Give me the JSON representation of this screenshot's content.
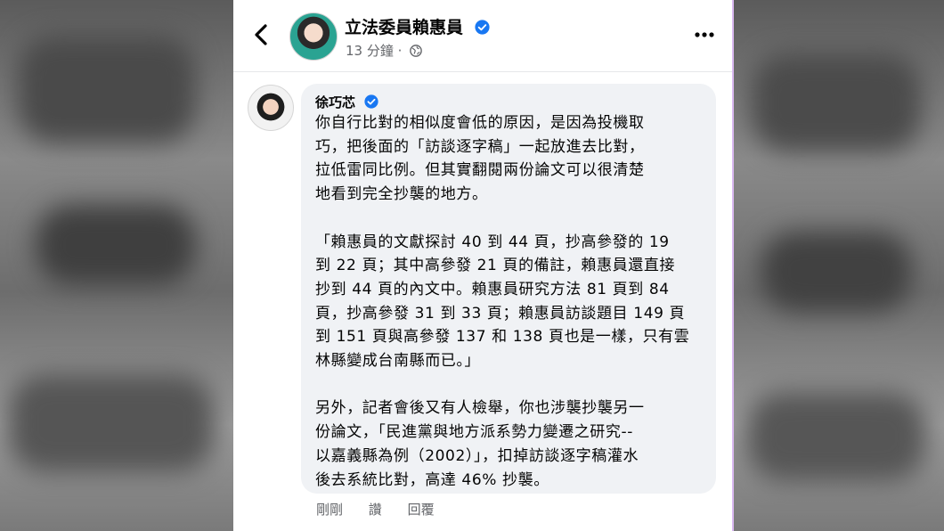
{
  "post": {
    "page_name": "立法委員賴惠員",
    "time": "13 分鐘",
    "separator": "·"
  },
  "comment": {
    "author": "徐巧芯",
    "paragraphs": [
      "你自行比對的相似度會低的原因，是因為投機取\n巧，把後面的「訪談逐字稿」一起放進去比對，\n拉低雷同比例。但其實翻閱兩份論文可以很清楚\n地看到完全抄襲的地方。",
      "「賴惠員的文獻探討 40 到 44 頁，抄高參發的 19\n到 22 頁；其中高參發 21 頁的備註，賴惠員還直接\n抄到 44 頁的內文中。賴惠員研究方法 81 頁到 84\n頁，抄高參發 31 到 33 頁；賴惠員訪談題目 149 頁\n到 151 頁與高參發 137 和 138 頁也是一樣，只有雲\n林縣變成台南縣而已。」",
      "另外，記者會後又有人檢舉，你也涉襲抄襲另一\n份論文，「民進黨與地方派系勢力變遷之研究--\n以嘉義縣為例（2002）」，扣掉訪談逐字稿灌水\n後去系統比對，高達 46% 抄襲。"
    ],
    "actions": {
      "time": "剛剛",
      "like": "讚",
      "reply": "回覆"
    }
  },
  "colors": {
    "verified_blue": "#1877f2",
    "bubble": "#f0f2f5",
    "secondary_text": "#65676b"
  },
  "icons": [
    "back-arrow-icon",
    "verified-badge-icon",
    "globe-icon",
    "more-dots-icon"
  ]
}
